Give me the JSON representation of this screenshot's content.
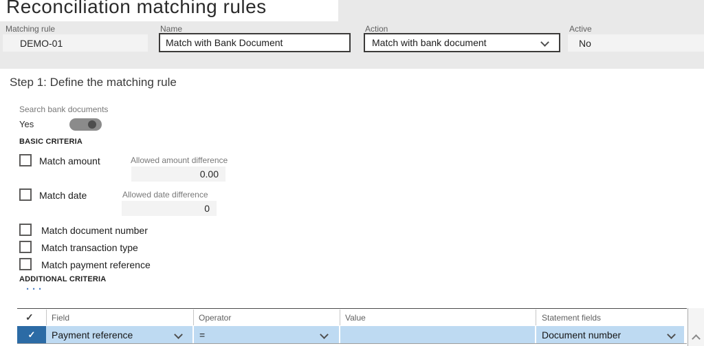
{
  "page": {
    "title": "Reconciliation matching rules"
  },
  "header": {
    "fields": [
      {
        "label": "Matching rule",
        "value": "DEMO-01",
        "type": "readonly"
      },
      {
        "label": "Name",
        "value": "Match with Bank Document",
        "type": "input"
      },
      {
        "label": "Action",
        "value": "Match with bank document",
        "type": "select"
      },
      {
        "label": "Active",
        "value": "No",
        "type": "readonly"
      }
    ]
  },
  "step": {
    "heading": "Step 1: Define the matching rule"
  },
  "search_toggle": {
    "label": "Search bank documents",
    "value": "Yes",
    "state": "on"
  },
  "basic_criteria": {
    "heading": "BASIC CRITERIA",
    "items": [
      {
        "label": "Match amount",
        "checked": false,
        "sub_label": "Allowed amount difference",
        "sub_value": "0.00"
      },
      {
        "label": "Match date",
        "checked": false,
        "sub_label": "Allowed date difference",
        "sub_value": "0"
      },
      {
        "label": "Match document number",
        "checked": false
      },
      {
        "label": "Match transaction type",
        "checked": false
      },
      {
        "label": "Match payment reference",
        "checked": false
      }
    ]
  },
  "additional_criteria": {
    "heading": "ADDITIONAL CRITERIA",
    "more_label": "···",
    "table": {
      "columns": [
        "Field",
        "Operator",
        "Value",
        "Statement fields"
      ],
      "rows": [
        {
          "selected": true,
          "field": "Payment reference",
          "operator": "=",
          "value": "",
          "statement_field": "Document number"
        }
      ]
    }
  },
  "icons": {
    "header_check": "✓",
    "row_check": "✓"
  },
  "colors": {
    "header_band": "#e9e9e9",
    "readonly_field": "#f3f3f3",
    "selected_cell": "#2c6ba5",
    "selected_row": "#bedaf2",
    "link_blue": "#4a7cc2",
    "toggle_track": "#8b8b8b",
    "toggle_knob": "#4d4d4d"
  }
}
